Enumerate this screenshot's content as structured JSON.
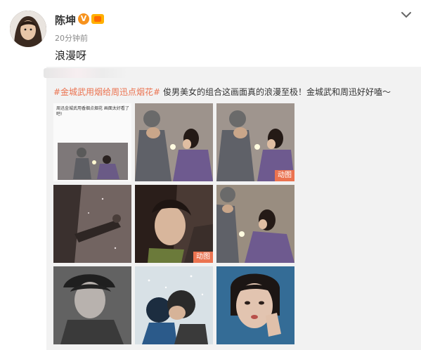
{
  "author": {
    "name": "陈坤",
    "verified_badge": "V",
    "time": "20分钟前"
  },
  "post": {
    "text": "浪漫呀"
  },
  "repost": {
    "hashtag": "#金城武用烟给周迅点烟花#",
    "text": " 俊男美女的组合这画面真的浪漫至极！金城武和周迅好好嗑～"
  },
  "images": [
    {
      "caption": "周迅金城武用香烟点烟花 画面太好看了吧!",
      "gif_label": ""
    },
    {
      "gif_label": ""
    },
    {
      "gif_label": "动图"
    },
    {
      "gif_label": ""
    },
    {
      "gif_label": "动图"
    },
    {
      "gif_label": ""
    },
    {
      "gif_label": ""
    },
    {
      "gif_label": ""
    },
    {
      "gif_label": ""
    }
  ],
  "gif_labels": {
    "img2": "动图",
    "img4": "动图",
    "img5": "动图"
  },
  "colors": {
    "accent": "#eb7350",
    "badge": "#f7931e",
    "repost_bg": "#f2f2f2"
  },
  "icons": {
    "chevron": "chevron-down-icon",
    "verified": "verified-v-icon",
    "level": "level-badge-icon"
  }
}
